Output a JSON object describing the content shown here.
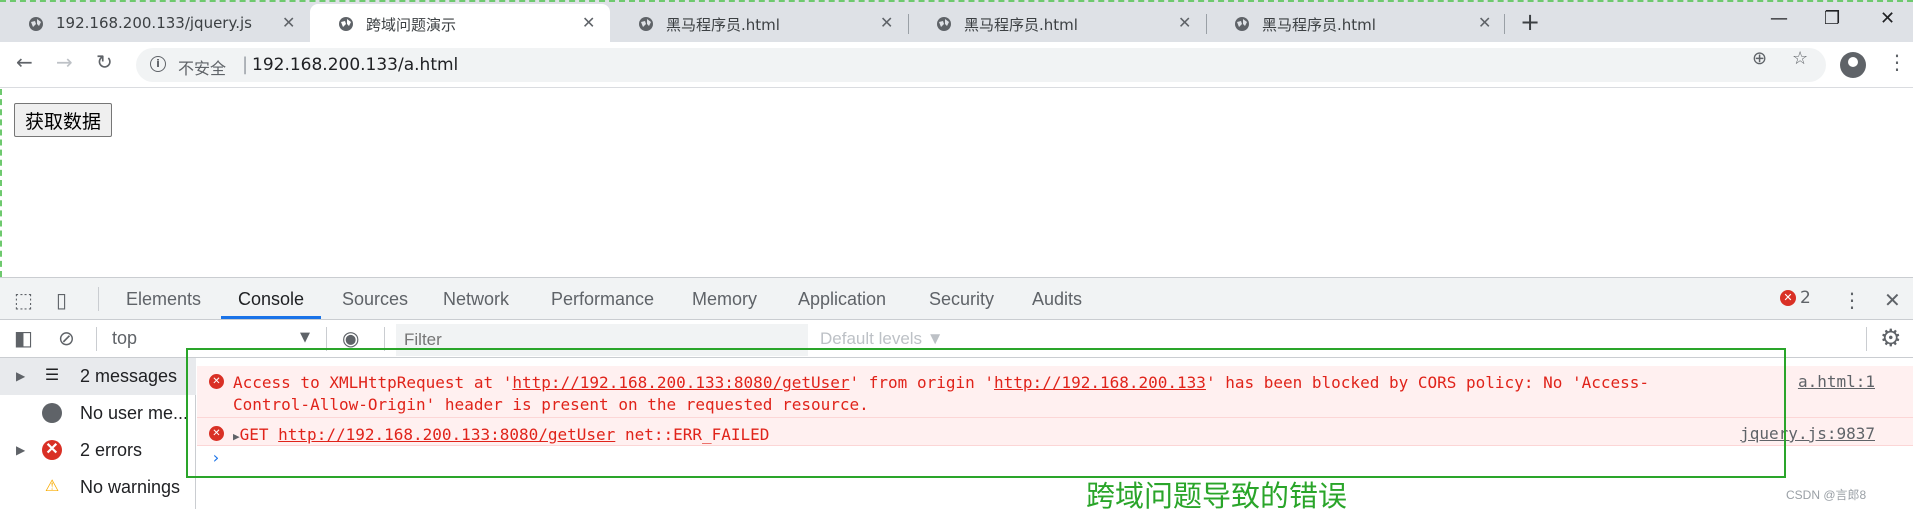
{
  "browser": {
    "tabs": [
      {
        "title": "192.168.200.133/jquery.js",
        "active": false
      },
      {
        "title": "跨域问题演示",
        "active": true
      },
      {
        "title": "黑马程序员.html",
        "active": false
      },
      {
        "title": "黑马程序员.html",
        "active": false
      },
      {
        "title": "黑马程序员.html",
        "active": false
      }
    ],
    "new_tab": "+",
    "window_controls": {
      "minimize": "—",
      "restore": "❐",
      "close": "✕"
    },
    "insecure_label": "不安全",
    "url": "192.168.200.133/a.html"
  },
  "page": {
    "button_label": "获取数据"
  },
  "devtools": {
    "tabs": [
      "Elements",
      "Console",
      "Sources",
      "Network",
      "Performance",
      "Memory",
      "Application",
      "Security",
      "Audits"
    ],
    "active_tab": "Console",
    "error_count": "2",
    "context": "top",
    "filter_placeholder": "Filter",
    "levels": "Default levels ▼",
    "sidebar": [
      {
        "label": "2 messages",
        "icon": "list-icon"
      },
      {
        "label": "No user me...",
        "icon": "user-icon"
      },
      {
        "label": "2 errors",
        "icon": "error-icon"
      },
      {
        "label": "No warnings",
        "icon": "warning-icon"
      }
    ],
    "messages": [
      {
        "pre1": "Access to XMLHttpRequest at '",
        "link1": "http://192.168.200.133:8080/getUser",
        "mid": "' from origin '",
        "link2": "http://192.168.200.133",
        "post": "' has been blocked by CORS policy: No 'Access-Control-Allow-Origin' header is present on the requested resource.",
        "source": "a.html:1"
      },
      {
        "pre1": "GET ",
        "link1": "http://192.168.200.133:8080/getUser",
        "post": " net::ERR_FAILED",
        "source": "jquery.js:9837"
      }
    ],
    "prompt": "›"
  },
  "annotation": "跨域问题导致的错误",
  "watermark": "CSDN @言郎8",
  "colors": {
    "error": "#d93025",
    "highlight": "#2aa52a",
    "accent": "#1a73e8"
  }
}
